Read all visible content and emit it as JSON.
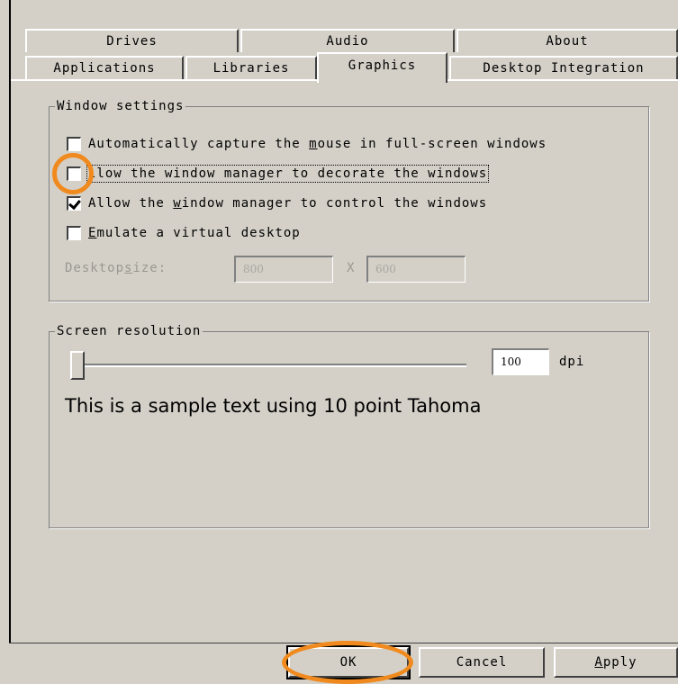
{
  "tabs": {
    "row1": [
      {
        "label": "Drives"
      },
      {
        "label": "Audio"
      },
      {
        "label": "About"
      }
    ],
    "row2": [
      {
        "label": "Applications"
      },
      {
        "label": "Libraries"
      },
      {
        "label": "Graphics",
        "selected": true
      },
      {
        "label": "Desktop Integration"
      }
    ]
  },
  "window_settings": {
    "title": "Window settings",
    "options": [
      {
        "pre": "Automatically capture the ",
        "key": "m",
        "post": "ouse in full-screen windows",
        "checked": false
      },
      {
        "pre": "",
        "key": "",
        "post": "llow the window manager to decorate the windows",
        "checked": false,
        "focused": true
      },
      {
        "pre": "Allow the ",
        "key": "w",
        "post": "indow manager to control the windows",
        "checked": true
      },
      {
        "pre": "",
        "key": "E",
        "post": "mulate a virtual desktop",
        "checked": false
      }
    ],
    "desktop_size": {
      "pre": "Desktop ",
      "key": "s",
      "post": "ize:",
      "width": "800",
      "separator": "X",
      "height": "600"
    }
  },
  "screen_resolution": {
    "title": "Screen resolution",
    "dpi_value": "100",
    "dpi_unit": "dpi",
    "sample_text": "This is a sample text using 10 point Tahoma"
  },
  "buttons": {
    "ok": "OK",
    "cancel": "Cancel",
    "apply_key": "A",
    "apply_rest": "pply"
  },
  "colors": {
    "background": "#d4d0c8",
    "highlight_ring": "#f08a1e"
  }
}
